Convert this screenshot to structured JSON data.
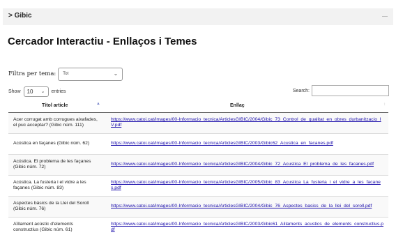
{
  "breadcrumb": "> Gibic",
  "page_title": "Cercador Interactiu - Enllaços i Temes",
  "filter": {
    "label": "Filtra per tema:",
    "selected": "Tot"
  },
  "length_menu": {
    "prefix": "Show",
    "value": "10",
    "suffix": "entries"
  },
  "search": {
    "label": "Search:",
    "value": ""
  },
  "table": {
    "headers": [
      "Títol article",
      "Enllaç"
    ],
    "rows": [
      {
        "title": "Acer corrugat amb corrugues aixafades, el puc acceptar? (Gibic núm. 111)",
        "link": "https://www.catoi.cat/images/00-Informacio_tecnica/ArticlesGIBIC/2004/Gibic_73_Control_de_qualitat_en_obres_durbanitzacio_IV.pdf"
      },
      {
        "title": "Acústica en façanes (Gibic núm. 62)",
        "link": "https://www.catoi.cat/images/00-Informacio_tecnica/ArticlesGIBIC/2003/Gibic62_Acustica_en_facanes.pdf"
      },
      {
        "title": "Acústica. El problema de les façanes (Gibic núm. 72)",
        "link": "https://www.catoi.cat/images/00-Informacio_tecnica/ArticlesGIBIC/2004/Gibic_72_Acustica_El_problema_de_les_facanes.pdf"
      },
      {
        "title": "Acústica. La fusteria i el vidre a les façanes (Gibic núm. 83)",
        "link": "https://www.catoi.cat/images/00-Informacio_tecnica/ArticlesGIBIC/2005/Gibic_83_Acustica_La_fusteria_i_el_vidre_a_les_facanes.pdf"
      },
      {
        "title": "Aspectes bàsics de la Llei del Soroll (Gibic núm. 76)",
        "link": "https://www.catoi.cat/images/00-Informacio_tecnica/ArticlesGIBIC/2004/Gibic_76_Aspectes_basics_de_la_llei_del_soroll.pdf"
      },
      {
        "title": "Aïllament acústic d'elements constructius (Gibic núm. 61)",
        "link": "https://www.catoi.cat/images/00-Informacio_tecnica/ArticlesGIBIC/2003/Gibic61_Aillaments_acustics_de_elements_constructius.pdf"
      }
    ]
  }
}
